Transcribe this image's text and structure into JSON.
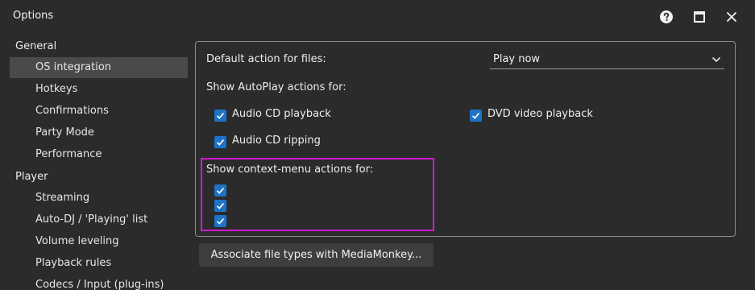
{
  "window": {
    "title": "Options",
    "help_icon": "help-circle-icon",
    "maximize_icon": "maximize-icon",
    "close_icon": "close-icon"
  },
  "sidebar": {
    "groups": [
      {
        "label": "General",
        "items": [
          "OS integration",
          "Hotkeys",
          "Confirmations",
          "Party Mode",
          "Performance"
        ]
      },
      {
        "label": "Player",
        "items": [
          "Streaming",
          "Auto-DJ / 'Playing' list",
          "Volume leveling",
          "Playback rules",
          "Codecs / Input (plug-ins)"
        ]
      }
    ],
    "active_item": "OS integration"
  },
  "main": {
    "default_action_label": "Default action for files:",
    "default_action_value": "Play now",
    "autoplay_label": "Show AutoPlay actions for:",
    "autoplay_options": [
      {
        "label": "Audio CD playback",
        "checked": true
      },
      {
        "label": "DVD video playback",
        "checked": true
      },
      {
        "label": "Audio CD ripping",
        "checked": true
      }
    ],
    "context_menu_label": "Show context-menu actions for:",
    "context_menu_checkboxes": [
      true,
      true,
      true
    ],
    "associate_button_label": "Associate file types with MediaMonkey..."
  },
  "colors": {
    "background": "#2b2b2b",
    "accent_checkbox": "#1e73c8",
    "highlight_box": "#d21ad2",
    "active_nav": "#4a4a4a"
  }
}
